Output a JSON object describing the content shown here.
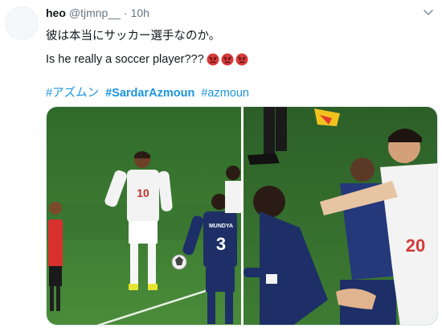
{
  "tweet": {
    "author_name": "heo",
    "author_handle": "@tjmnp__",
    "separator": "·",
    "timestamp": "10h",
    "text_japanese": "彼は本当にサッカー選手なのか。",
    "text_english": "Is he really a soccer player???",
    "emojis": [
      "angry-face-icon",
      "angry-face-icon",
      "angry-face-icon"
    ],
    "hashtags": [
      "#アズムン",
      "#SardarAzmoun",
      "#azmoun"
    ],
    "shirt_number_white": "10",
    "shirt_number_blue": "3",
    "shirt_name_blue": "MUNDYA",
    "shirt_number_right": "20"
  },
  "colors": {
    "link": "#1b95e0",
    "text": "#14171a",
    "muted": "#657786",
    "pitch": "#3f7a33",
    "japan_kit": "#1d2f66",
    "iran_kit": "#f3f3f3",
    "emoji_red": "#d83a3a"
  }
}
